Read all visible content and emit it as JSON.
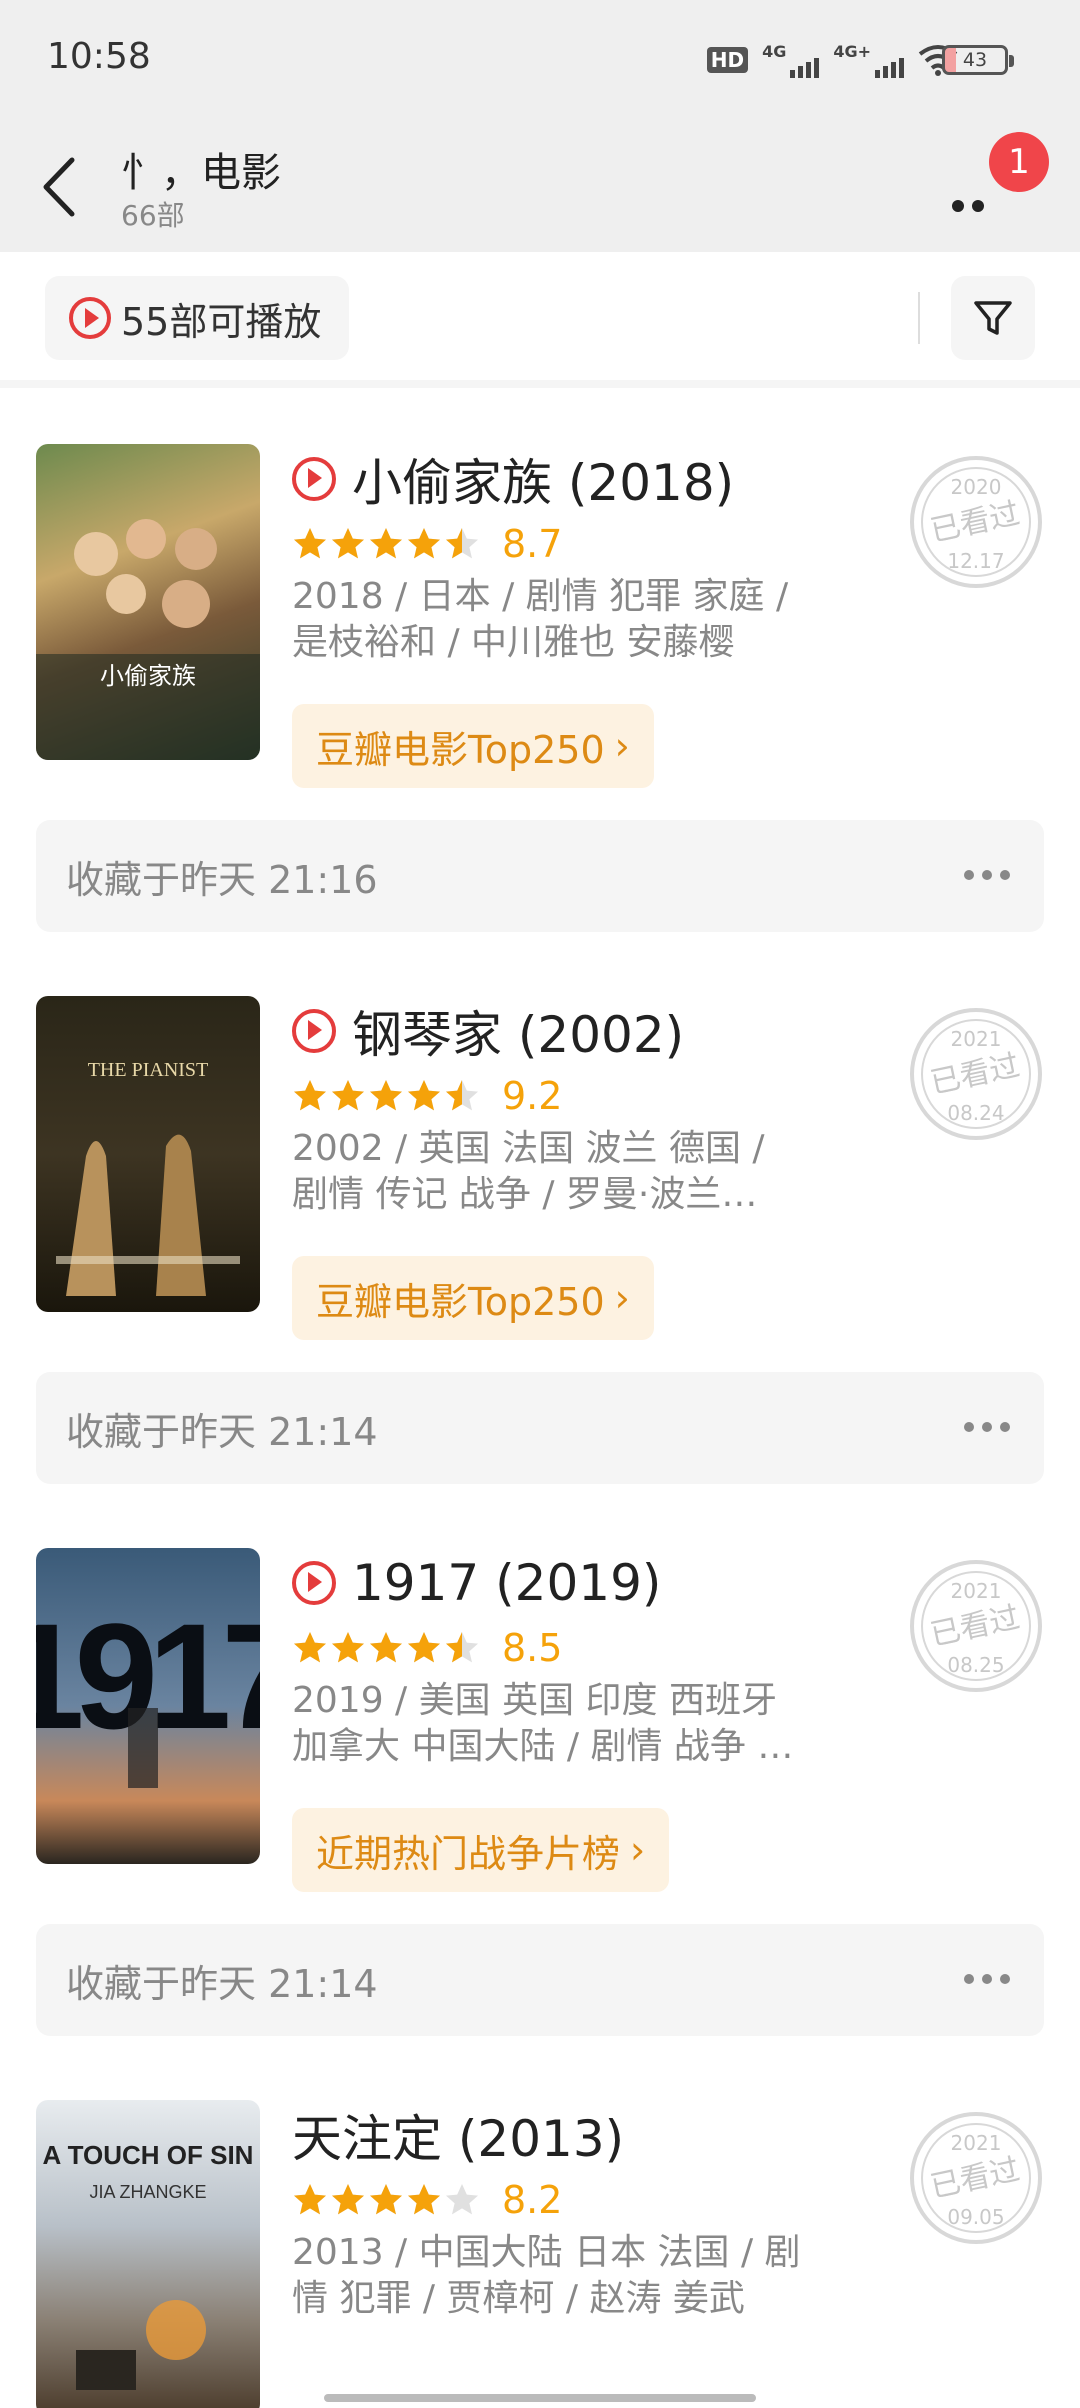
{
  "status_bar": {
    "time": "10:58",
    "hd": "HD",
    "net1": "4G",
    "net2": "4G+",
    "battery": "43",
    "icons": [
      "hd-icon",
      "signal-icon",
      "signal-icon",
      "wifi-icon",
      "battery-icon"
    ]
  },
  "header": {
    "title": "忄，电影",
    "subtitle": "66部",
    "badge_count": "1",
    "icons": [
      "back-icon",
      "more-icon"
    ]
  },
  "filter": {
    "playable_label": "55部可播放",
    "icons": [
      "play-icon",
      "filter-icon"
    ]
  },
  "colors": {
    "accent_red": "#e43c3c",
    "star_orange": "#f5a20a",
    "tag_bg": "#fdf2e1",
    "tag_text": "#dd8a14"
  },
  "movies": [
    {
      "title": "小偷家族 (2018)",
      "playable": true,
      "rating": 8.7,
      "stars": 4.5,
      "score_text": "8.7",
      "meta": [
        "2018 / 日本 / 剧情 犯罪 家庭 /",
        "是枝裕和 / 中川雅也 安藤樱"
      ],
      "tag": "豆瓣电影Top250",
      "stamp_year": "2020",
      "stamp_text": "已看过",
      "stamp_date": "12.17",
      "collected": "收藏于昨天 21:16"
    },
    {
      "title": "钢琴家 (2002)",
      "playable": true,
      "rating": 9.2,
      "stars": 4.5,
      "score_text": "9.2",
      "meta": [
        "2002 / 英国 法国 波兰 德国 /",
        "剧情 传记 战争 / 罗曼·波兰…"
      ],
      "tag": "豆瓣电影Top250",
      "stamp_year": "2021",
      "stamp_text": "已看过",
      "stamp_date": "08.24",
      "collected": "收藏于昨天 21:14"
    },
    {
      "title": "1917 (2019)",
      "playable": true,
      "rating": 8.5,
      "stars": 4.5,
      "score_text": "8.5",
      "meta": [
        "2019 / 美国 英国 印度 西班牙",
        "加拿大 中国大陆 / 剧情 战争 …"
      ],
      "tag": "近期热门战争片榜",
      "stamp_year": "2021",
      "stamp_text": "已看过",
      "stamp_date": "08.25",
      "collected": "收藏于昨天 21:14"
    },
    {
      "title": "天注定 (2013)",
      "playable": false,
      "rating": 8.2,
      "stars": 4,
      "score_text": "8.2",
      "meta": [
        "2013 / 中国大陆 日本 法国 / 剧",
        "情 犯罪 / 贾樟柯 / 赵涛 姜武"
      ],
      "tag": "",
      "stamp_year": "2021",
      "stamp_text": "已看过",
      "stamp_date": "09.05",
      "collected": ""
    }
  ],
  "posters": [
    {
      "text": "小偷家族"
    },
    {
      "text": "THE PIANIST"
    },
    {
      "text": "1917"
    },
    {
      "text": "A TOUCH OF SIN",
      "sub": "JIA ZHANGKE"
    }
  ]
}
